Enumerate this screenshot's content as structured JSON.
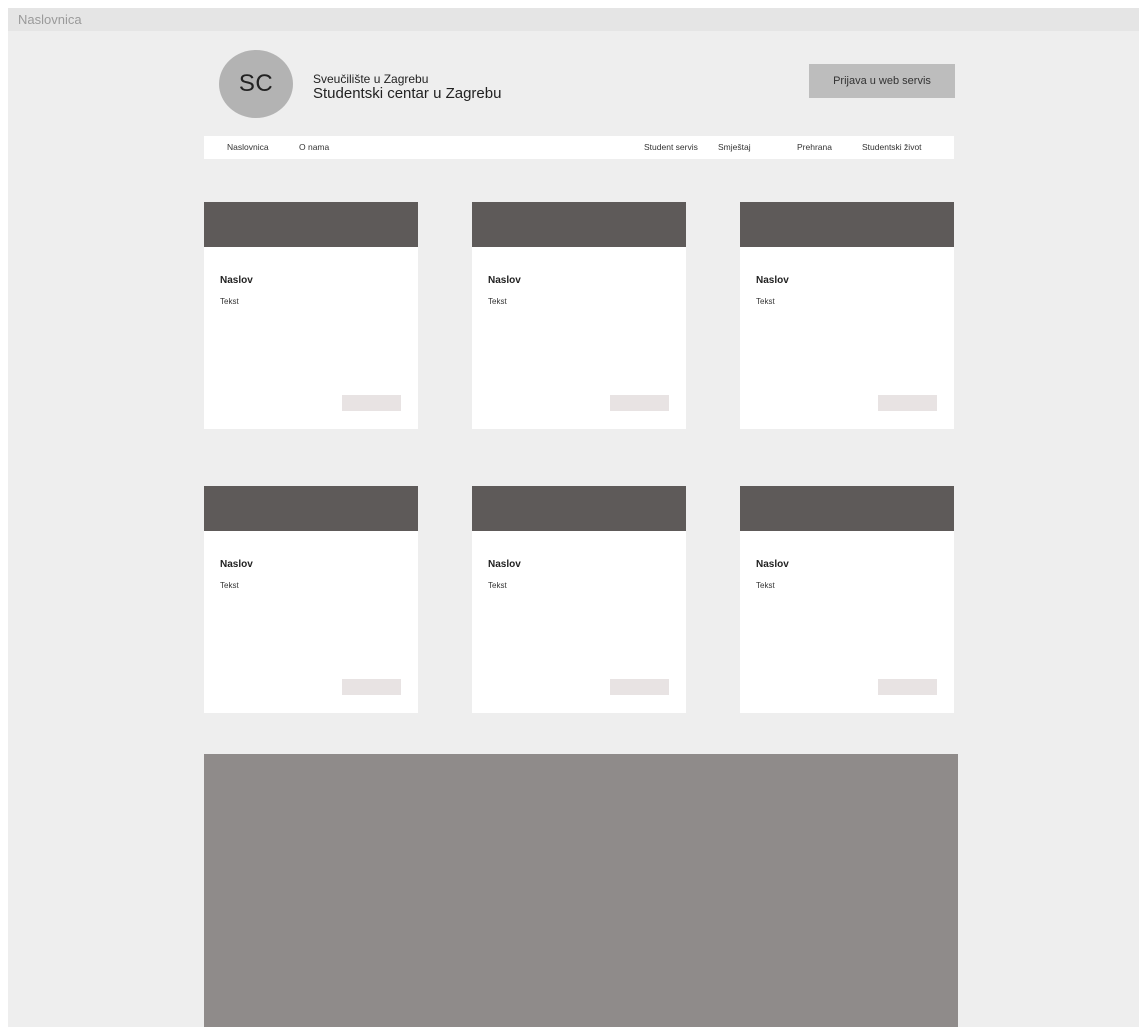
{
  "frame": {
    "title": "Naslovnica"
  },
  "header": {
    "logo_text": "SC",
    "org_line1": "Sveučilište u Zagrebu",
    "org_line2": "Studentski centar u Zagrebu",
    "login_label": "Prijava u web servis"
  },
  "nav": {
    "items": [
      {
        "label": "Naslovnica"
      },
      {
        "label": "O nama"
      },
      {
        "label": "Student servis"
      },
      {
        "label": "Smještaj"
      },
      {
        "label": "Prehrana"
      },
      {
        "label": "Studentski život"
      }
    ]
  },
  "cards": [
    {
      "title": "Naslov",
      "text": "Tekst"
    },
    {
      "title": "Naslov",
      "text": "Tekst"
    },
    {
      "title": "Naslov",
      "text": "Tekst"
    },
    {
      "title": "Naslov",
      "text": "Tekst"
    },
    {
      "title": "Naslov",
      "text": "Tekst"
    },
    {
      "title": "Naslov",
      "text": "Tekst"
    }
  ],
  "colors": {
    "canvas_bg": "#eeeeee",
    "card_image": "#5e5a59",
    "card_button": "#e8e3e3",
    "footer_block": "#8f8b8a",
    "login_button": "#bdbdbd",
    "logo_circle": "#b3b3b3"
  }
}
